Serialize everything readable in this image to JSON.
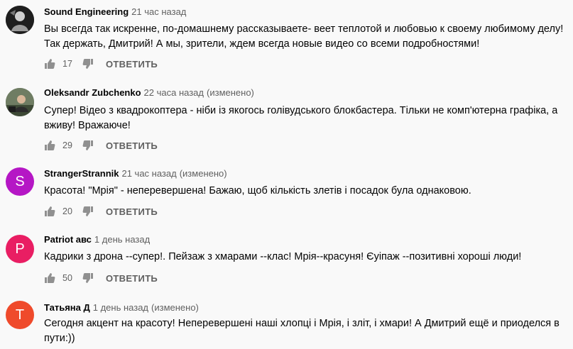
{
  "reply_label": "ОТВЕТИТЬ",
  "edited_label": "(изменено)",
  "comments": [
    {
      "author": "Sound Engineering",
      "time": "21 час назад",
      "edited": false,
      "text": "Вы всегда так искренне, по-домашнему рассказываете- веет теплотой и любовью к своему любимому делу! Так держать, Дмитрий! А мы, зрители, ждем всегда новые видео со всеми подробностями!",
      "likes": "17",
      "avatar": {
        "type": "image",
        "color": "#2b2b2b"
      }
    },
    {
      "author": "Oleksandr Zubchenko",
      "time": "22 часа назад",
      "edited": true,
      "text": "Супер! Відео з квадрокоптера - ніби із якогось голівудського блокбастера. Тільки не комп'ютерна графіка, а вживу! Вражаюче!",
      "likes": "29",
      "avatar": {
        "type": "image",
        "color": "#5a6b52"
      }
    },
    {
      "author": "StrangerStrannik",
      "time": "21 час назад",
      "edited": true,
      "text": "Красота! \"Мрія\" - неперевершена! Бажаю, щоб кількість злетів і посадок була однаковою.",
      "likes": "20",
      "avatar": {
        "type": "letter",
        "letter": "S",
        "color": "#b517c5"
      }
    },
    {
      "author": "Patriot авс",
      "time": "1 день назад",
      "edited": false,
      "text": "Кадрики з дрона --супер!. Пейзаж з хмарами --клас! Мрія--красуня! Єуіпаж --позитивні хороші люди!",
      "likes": "50",
      "avatar": {
        "type": "letter",
        "letter": "P",
        "color": "#e91e63"
      }
    },
    {
      "author": "Татьяна Д",
      "time": "1 день назад",
      "edited": true,
      "text": "Сегодня акцент на красоту! Неперевершені наші хлопці і Мрія, і зліт, і хмари! А Дмитрий ещё и приоделся в пути:))",
      "likes": "",
      "avatar": {
        "type": "letter",
        "letter": "T",
        "color": "#ef4a2b"
      }
    }
  ]
}
